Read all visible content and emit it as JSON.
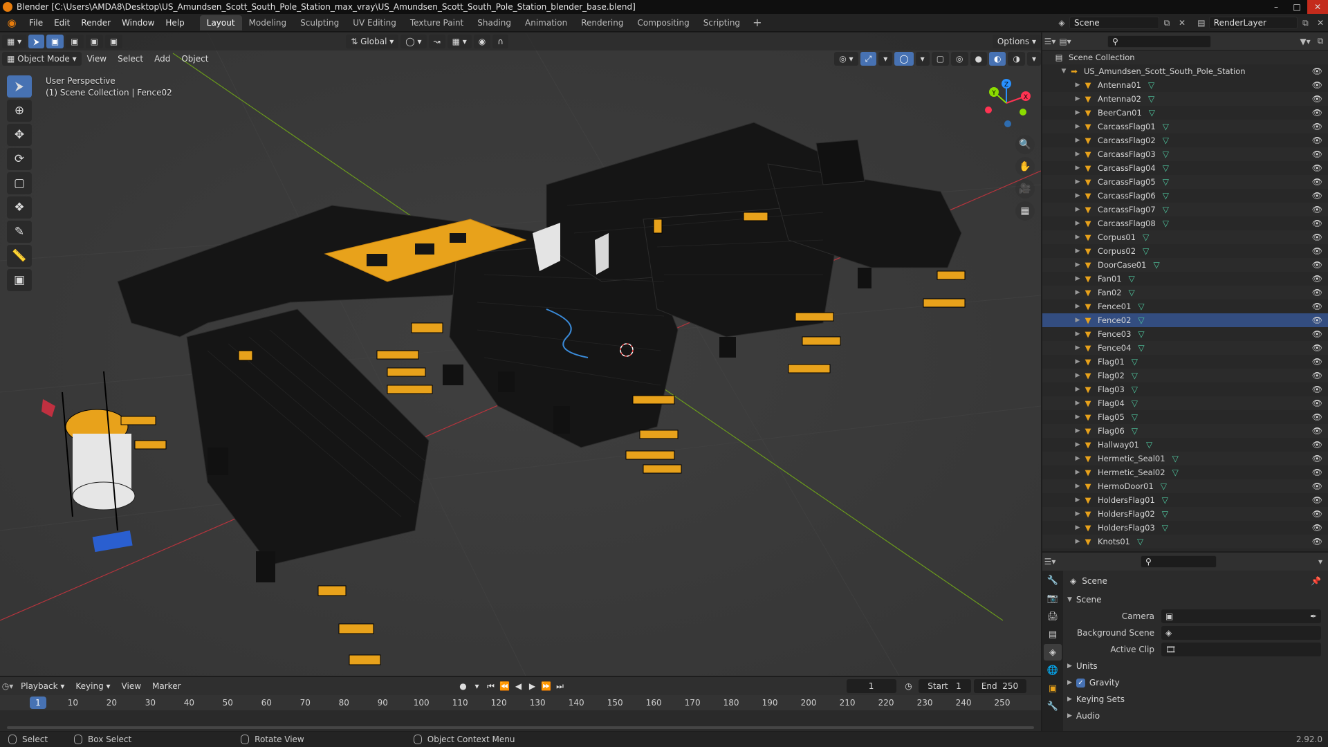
{
  "window": {
    "title": "Blender [C:\\Users\\AMDA8\\Desktop\\US_Amundsen_Scott_South_Pole_Station_max_vray\\US_Amundsen_Scott_South_Pole_Station_blender_base.blend]"
  },
  "menu": {
    "items": [
      "File",
      "Edit",
      "Render",
      "Window",
      "Help"
    ]
  },
  "workspaces": {
    "tabs": [
      "Layout",
      "Modeling",
      "Sculpting",
      "UV Editing",
      "Texture Paint",
      "Shading",
      "Animation",
      "Rendering",
      "Compositing",
      "Scripting"
    ],
    "active": "Layout",
    "add": "+"
  },
  "scene_selector": {
    "value": "Scene"
  },
  "view_layer_selector": {
    "value": "RenderLayer"
  },
  "viewport": {
    "transform_orientation": "Global",
    "options": "Options",
    "mode": "Object Mode",
    "menus": [
      "View",
      "Select",
      "Add",
      "Object"
    ],
    "overlay_line1": "User Perspective",
    "overlay_line2": "(1) Scene Collection | Fence02",
    "gizmo_axes": {
      "x": "X",
      "y": "Y",
      "z": "Z"
    }
  },
  "colors": {
    "accent": "#4772b3",
    "orange": "#e8a21b",
    "x_axis": "#ff3352",
    "y_axis": "#8bdc00",
    "z_axis": "#2890ff",
    "mesh_icon": "#4fc9a0"
  },
  "outliner": {
    "root": "Scene Collection",
    "collection": "US_Amundsen_Scott_South_Pole_Station",
    "objects": [
      {
        "name": "Antenna01"
      },
      {
        "name": "Antenna02"
      },
      {
        "name": "BeerCan01"
      },
      {
        "name": "CarcassFlag01"
      },
      {
        "name": "CarcassFlag02"
      },
      {
        "name": "CarcassFlag03"
      },
      {
        "name": "CarcassFlag04"
      },
      {
        "name": "CarcassFlag05"
      },
      {
        "name": "CarcassFlag06"
      },
      {
        "name": "CarcassFlag07"
      },
      {
        "name": "CarcassFlag08"
      },
      {
        "name": "Corpus01"
      },
      {
        "name": "Corpus02"
      },
      {
        "name": "DoorCase01"
      },
      {
        "name": "Fan01"
      },
      {
        "name": "Fan02"
      },
      {
        "name": "Fence01"
      },
      {
        "name": "Fence02",
        "selected": true
      },
      {
        "name": "Fence03"
      },
      {
        "name": "Fence04"
      },
      {
        "name": "Flag01"
      },
      {
        "name": "Flag02"
      },
      {
        "name": "Flag03"
      },
      {
        "name": "Flag04"
      },
      {
        "name": "Flag05"
      },
      {
        "name": "Flag06"
      },
      {
        "name": "Hallway01"
      },
      {
        "name": "Hermetic_Seal01"
      },
      {
        "name": "Hermetic_Seal02"
      },
      {
        "name": "HermoDoor01"
      },
      {
        "name": "HoldersFlag01"
      },
      {
        "name": "HoldersFlag02"
      },
      {
        "name": "HoldersFlag03"
      },
      {
        "name": "Knots01"
      }
    ]
  },
  "properties": {
    "context": "Scene",
    "panel": "Scene",
    "camera_label": "Camera",
    "background_scene_label": "Background Scene",
    "active_clip_label": "Active Clip",
    "sections": [
      "Units",
      "Gravity",
      "Keying Sets",
      "Audio"
    ]
  },
  "timeline": {
    "menus": [
      "Playback",
      "Keying",
      "View",
      "Marker"
    ],
    "current_frame": "1",
    "start_label": "Start",
    "start": "1",
    "end_label": "End",
    "end": "250",
    "ticks": [
      "10",
      "20",
      "30",
      "40",
      "50",
      "60",
      "70",
      "80",
      "90",
      "100",
      "110",
      "120",
      "130",
      "140",
      "150",
      "160",
      "170",
      "180",
      "190",
      "200",
      "210",
      "220",
      "230",
      "240",
      "250"
    ],
    "cursor_label": "1"
  },
  "statusbar": {
    "select": "Select",
    "box_select": "Box Select",
    "rotate_view": "Rotate View",
    "context_menu": "Object Context Menu",
    "version": "2.92.0"
  }
}
